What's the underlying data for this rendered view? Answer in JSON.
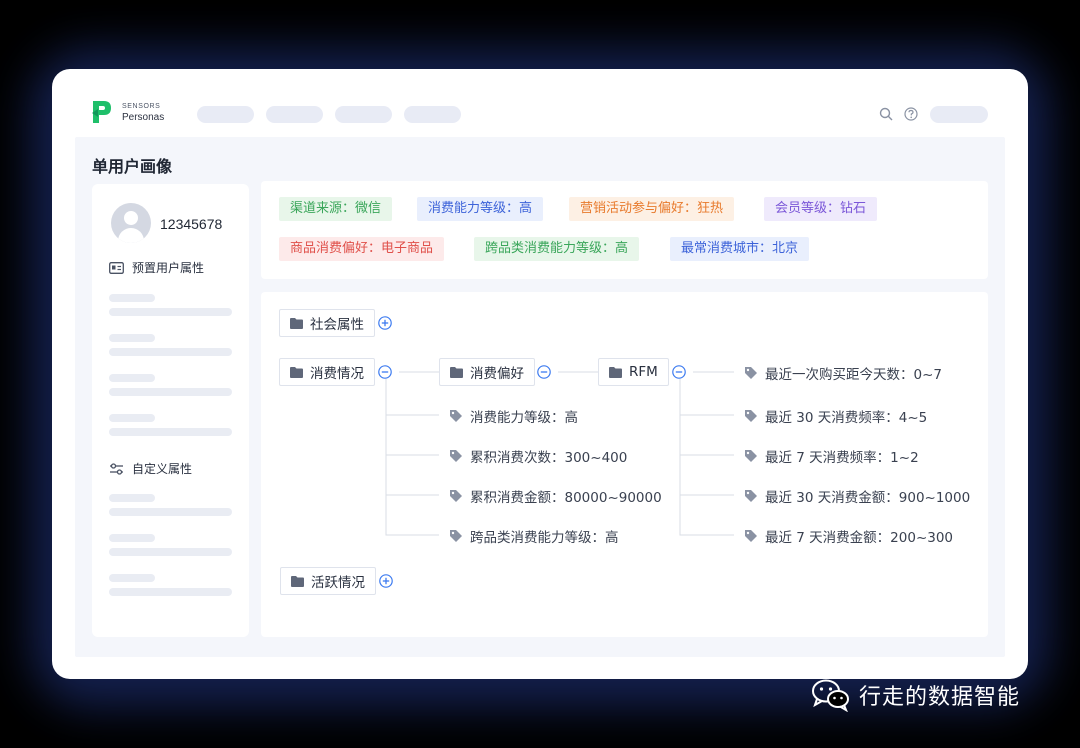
{
  "brand": {
    "top": "SENSORS",
    "bottom": "Personas"
  },
  "page_title": "单用户画像",
  "user": {
    "id": "12345678"
  },
  "sidebar": {
    "preset_label": "预置用户属性",
    "custom_label": "自定义属性"
  },
  "tags": [
    {
      "text": "渠道来源：微信",
      "color": "#3aa65a",
      "bg": "#e8f6ea"
    },
    {
      "text": "消费能力等级：高",
      "color": "#3d63d9",
      "bg": "#e9effd"
    },
    {
      "text": "营销活动参与偏好：狂热",
      "color": "#e87a2c",
      "bg": "#fdf0e4"
    },
    {
      "text": "会员等级：钻石",
      "color": "#7b57d8",
      "bg": "#efeafc"
    },
    {
      "text": "商品消费偏好：电子商品",
      "color": "#e0504a",
      "bg": "#fdeaea"
    },
    {
      "text": "跨品类消费能力等级：高",
      "color": "#3aa65a",
      "bg": "#e8f6ea"
    },
    {
      "text": "最常消费城市：北京",
      "color": "#3d63d9",
      "bg": "#e9effd"
    }
  ],
  "tree": {
    "social": "社会属性",
    "consume": "消费情况",
    "preference": "消费偏好",
    "rfm": "RFM",
    "activity": "活跃情况",
    "consume_leaves": [
      "消费能力等级：高",
      "累积消费次数：300~400",
      "累积消费金额：80000~90000",
      "跨品类消费能力等级：高"
    ],
    "rfm_leaves": [
      "最近一次购买距今天数：0~7",
      "最近 30 天消费频率：4~5",
      "最近 7 天消费频率：1~2",
      "最近 30 天消费金额：900~1000",
      "最近 7 天消费金额：200~300"
    ]
  },
  "watermark": "行走的数据智能",
  "icons": [
    "search-icon",
    "help-icon",
    "folder-icon",
    "tag-icon",
    "expand-icon",
    "collapse-icon",
    "id-card-icon",
    "sliders-icon",
    "wechat-icon"
  ]
}
